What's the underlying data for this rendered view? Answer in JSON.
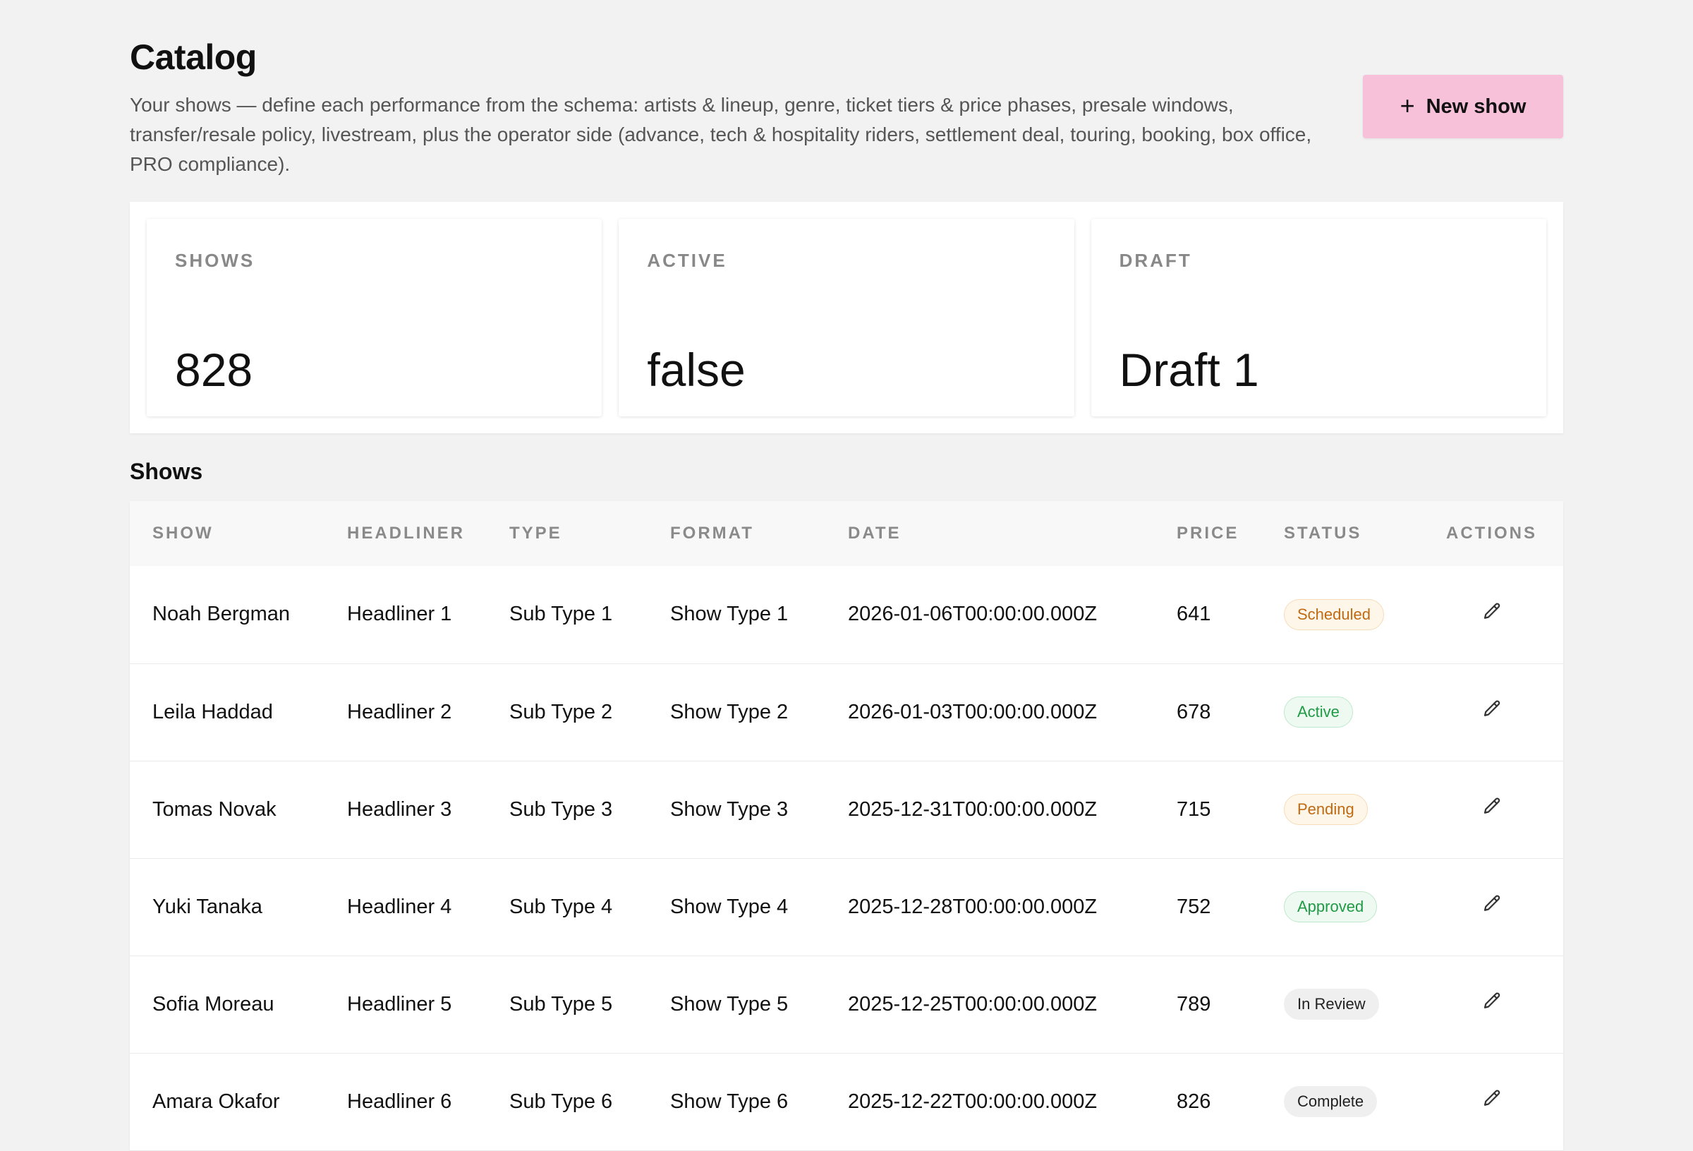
{
  "header": {
    "title": "Catalog",
    "description": "Your shows — define each performance from the schema: artists & lineup, genre, ticket tiers & price phases, presale windows, transfer/resale policy, livestream, plus the operator side (advance, tech & hospitality riders, settlement deal, touring, booking, box office, PRO compliance).",
    "new_button_label": "New show",
    "new_button_icon": "plus-icon"
  },
  "stats": [
    {
      "label": "SHOWS",
      "value": "828"
    },
    {
      "label": "ACTIVE",
      "value": "false"
    },
    {
      "label": "DRAFT",
      "value": "Draft 1"
    }
  ],
  "section_title": "Shows",
  "table": {
    "columns": [
      "SHOW",
      "HEADLINER",
      "TYPE",
      "FORMAT",
      "DATE",
      "PRICE",
      "STATUS",
      "ACTIONS"
    ],
    "rows": [
      {
        "show": "Noah Bergman",
        "headliner": "Headliner 1",
        "type": "Sub Type 1",
        "format": "Show Type 1",
        "date": "2026-01-06T00:00:00.000Z",
        "price": "641",
        "status": "Scheduled",
        "status_color": "orange"
      },
      {
        "show": "Leila Haddad",
        "headliner": "Headliner 2",
        "type": "Sub Type 2",
        "format": "Show Type 2",
        "date": "2026-01-03T00:00:00.000Z",
        "price": "678",
        "status": "Active",
        "status_color": "green"
      },
      {
        "show": "Tomas Novak",
        "headliner": "Headliner 3",
        "type": "Sub Type 3",
        "format": "Show Type 3",
        "date": "2025-12-31T00:00:00.000Z",
        "price": "715",
        "status": "Pending",
        "status_color": "orange"
      },
      {
        "show": "Yuki Tanaka",
        "headliner": "Headliner 4",
        "type": "Sub Type 4",
        "format": "Show Type 4",
        "date": "2025-12-28T00:00:00.000Z",
        "price": "752",
        "status": "Approved",
        "status_color": "green"
      },
      {
        "show": "Sofia Moreau",
        "headliner": "Headliner 5",
        "type": "Sub Type 5",
        "format": "Show Type 5",
        "date": "2025-12-25T00:00:00.000Z",
        "price": "789",
        "status": "In Review",
        "status_color": "gray"
      },
      {
        "show": "Amara Okafor",
        "headliner": "Headliner 6",
        "type": "Sub Type 6",
        "format": "Show Type 6",
        "date": "2025-12-22T00:00:00.000Z",
        "price": "826",
        "status": "Complete",
        "status_color": "gray"
      }
    ]
  },
  "colors": {
    "background": "#f2f2f2",
    "primary_button": "#f7c1da",
    "badge_orange": "#c06a12",
    "badge_green": "#1f9a45"
  }
}
